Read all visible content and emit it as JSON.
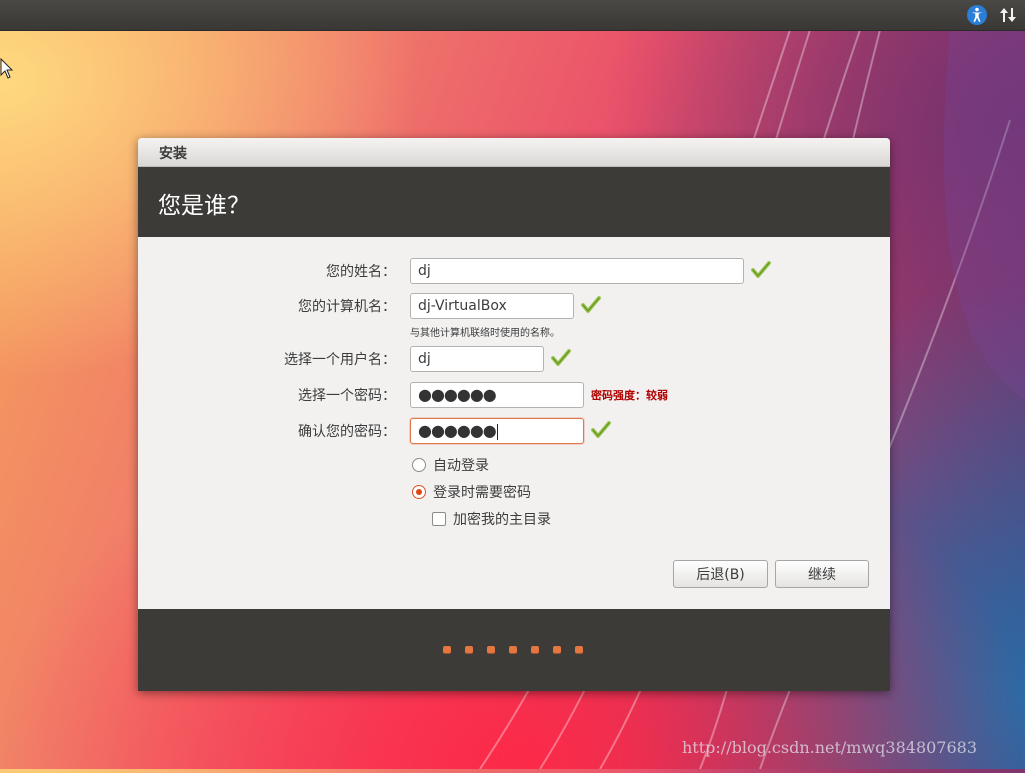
{
  "window": {
    "title": "安装"
  },
  "header": {
    "heading": "您是谁？"
  },
  "form": {
    "name_label": "您的姓名：",
    "name_value": "dj",
    "computer_label": "您的计算机名：",
    "computer_value": "dj-VirtualBox",
    "computer_hint": "与其他计算机联络时使用的名称。",
    "username_label": "选择一个用户名：",
    "username_value": "dj",
    "password_label": "选择一个密码：",
    "password_value": "●●●●●●",
    "password_strength": "密码强度：较弱",
    "confirm_label": "确认您的密码：",
    "confirm_value": "●●●●●●",
    "auto_login_label": "自动登录",
    "require_password_label": "登录时需要密码",
    "encrypt_home_label": "加密我的主目录",
    "login_option_selected": "require_password",
    "encrypt_home_checked": false
  },
  "buttons": {
    "back_label": "后退(B)",
    "continue_label": "继续"
  },
  "progress": {
    "total_steps": 7
  },
  "watermark": "http://blog.csdn.net/mwq384807683",
  "colors": {
    "accent": "#dd4814",
    "header_bg": "#3c3b37",
    "check_green": "#7aa82a",
    "strength_text": "#b00000"
  },
  "icons": {
    "top_right": [
      "accessibility-icon",
      "network-transfer-icon"
    ],
    "field_status": "checkmark-icon"
  }
}
